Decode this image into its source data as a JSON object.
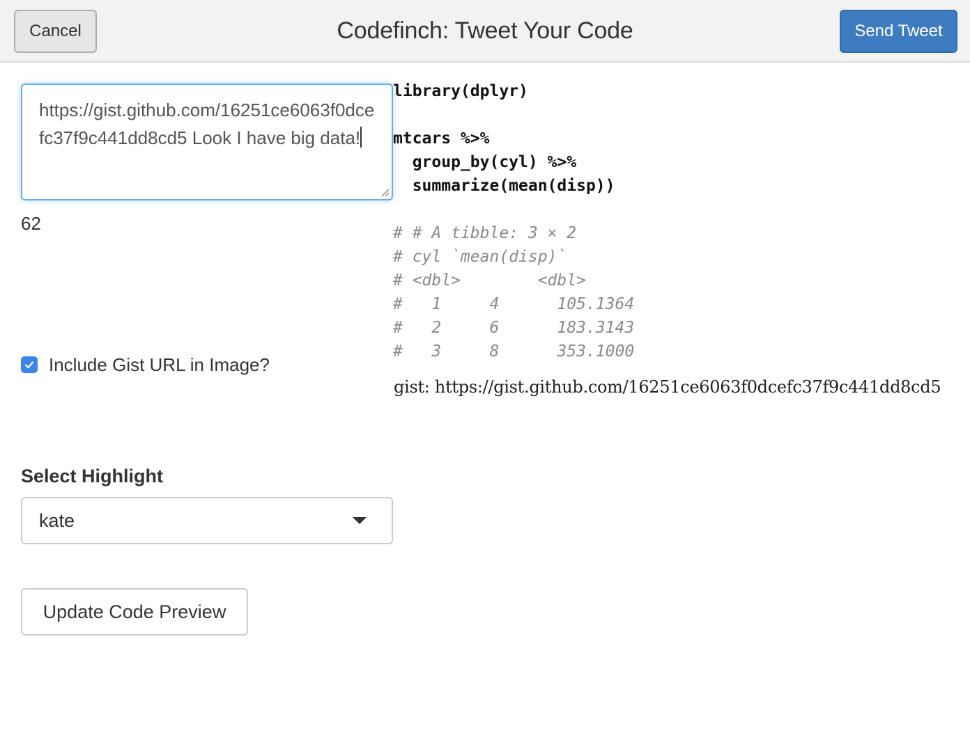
{
  "header": {
    "cancel_label": "Cancel",
    "title": "Codefinch: Tweet Your Code",
    "send_label": "Send Tweet"
  },
  "tweet": {
    "text": "https://gist.github.com/16251ce6063f0dcefc37f9c441dd8cd5 Look I have big data!",
    "char_count": "62"
  },
  "options": {
    "include_gist_label": "Include Gist URL in Image?",
    "include_gist_checked": true,
    "select_highlight_label": "Select Highlight",
    "highlight_value": "kate",
    "update_button_label": "Update Code Preview"
  },
  "preview": {
    "code_lines": [
      {
        "text": "library(dplyr)",
        "style": "bold"
      },
      {
        "text": "",
        "style": "normal"
      },
      {
        "text": "mtcars %>%",
        "style": "bold"
      },
      {
        "text": "  group_by(cyl) %>%",
        "style": "bold"
      },
      {
        "text": "  summarize(mean(disp))",
        "style": "bold"
      },
      {
        "text": "",
        "style": "normal"
      },
      {
        "text": "# # A tibble: 3 × 2",
        "style": "comment"
      },
      {
        "text": "# cyl `mean(disp)`",
        "style": "comment"
      },
      {
        "text": "# <dbl>        <dbl>",
        "style": "comment"
      },
      {
        "text": "#   1     4      105.1364",
        "style": "comment"
      },
      {
        "text": "#   2     6      183.3143",
        "style": "comment"
      },
      {
        "text": "#   3     8      353.1000",
        "style": "comment"
      }
    ],
    "gist_line": "gist: https://gist.github.com/16251ce6063f0dcefc37f9c441dd8cd5"
  },
  "colors": {
    "primary": "#3e7cc2",
    "focus_border": "#66afe9",
    "checkbox": "#3a86e8",
    "comment": "#8a8a8a"
  },
  "icons": {
    "checkbox": "check-icon",
    "select_caret": "chevron-down-icon",
    "resize": "resize-grip-icon"
  }
}
